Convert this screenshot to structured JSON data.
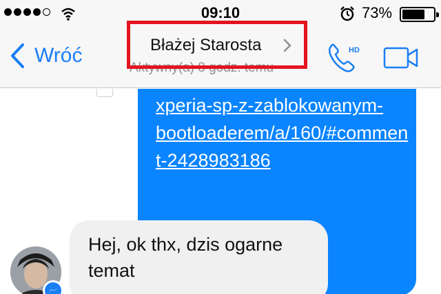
{
  "status_bar": {
    "time": "09:10",
    "battery_percent": "73%",
    "battery_level": 0.73,
    "signal_bars_filled": 4,
    "signal_bars_total": 5
  },
  "nav": {
    "back_label": "Wróć",
    "contact_name": "Błażej Starosta",
    "active_status": "Aktywny(a) 8 godz. temu",
    "call_badge": "HD",
    "accent_color": "#1a7ef5",
    "highlight_color": "#e3141e"
  },
  "messages": {
    "outgoing_text": "xperia-sp-z-zablokowanym-bootloaderem/a/160/#comment-2428983186",
    "incoming_text": "Hej, ok thx, dzis ogarne temat",
    "outgoing_color": "#0a84ff"
  },
  "icons": {
    "back": "chevron-left-icon",
    "call": "phone-hd-icon",
    "video": "video-camera-icon",
    "badge": "messenger-icon"
  }
}
